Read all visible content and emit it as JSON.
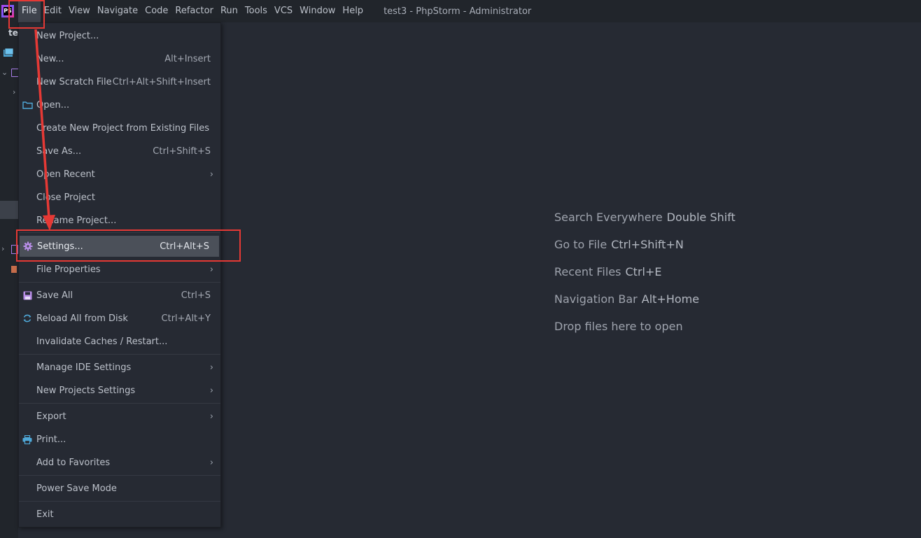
{
  "menubar": {
    "logo_text": "PS",
    "items": [
      "File",
      "Edit",
      "View",
      "Navigate",
      "Code",
      "Refactor",
      "Run",
      "Tools",
      "VCS",
      "Window",
      "Help"
    ],
    "window_title": "test3 - PhpStorm - Administrator"
  },
  "project_panel": {
    "tab_label": "te"
  },
  "file_menu": {
    "items": [
      {
        "label": "New Project...",
        "shortcut": "",
        "icon": "",
        "submenu": false
      },
      {
        "label": "New...",
        "shortcut": "Alt+Insert",
        "icon": "",
        "submenu": false
      },
      {
        "label": "New Scratch File",
        "shortcut": "Ctrl+Alt+Shift+Insert",
        "icon": "",
        "submenu": false
      },
      {
        "label": "Open...",
        "shortcut": "",
        "icon": "folder-icon",
        "submenu": false
      },
      {
        "label": "Create New Project from Existing Files",
        "shortcut": "",
        "icon": "",
        "submenu": false
      },
      {
        "label": "Save As...",
        "shortcut": "Ctrl+Shift+S",
        "icon": "",
        "submenu": false
      },
      {
        "label": "Open Recent",
        "shortcut": "",
        "icon": "",
        "submenu": true
      },
      {
        "label": "Close Project",
        "shortcut": "",
        "icon": "",
        "submenu": false
      },
      {
        "label": "Rename Project...",
        "shortcut": "",
        "icon": "",
        "submenu": false
      },
      {
        "label": "Settings...",
        "shortcut": "Ctrl+Alt+S",
        "icon": "gear-icon",
        "submenu": false,
        "selected": true
      },
      {
        "label": "File Properties",
        "shortcut": "",
        "icon": "",
        "submenu": true
      },
      {
        "label": "Save All",
        "shortcut": "Ctrl+S",
        "icon": "save-icon",
        "submenu": false
      },
      {
        "label": "Reload All from Disk",
        "shortcut": "Ctrl+Alt+Y",
        "icon": "reload-icon",
        "submenu": false
      },
      {
        "label": "Invalidate Caches / Restart...",
        "shortcut": "",
        "icon": "",
        "submenu": false
      },
      {
        "label": "Manage IDE Settings",
        "shortcut": "",
        "icon": "",
        "submenu": true
      },
      {
        "label": "New Projects Settings",
        "shortcut": "",
        "icon": "",
        "submenu": true
      },
      {
        "label": "Export",
        "shortcut": "",
        "icon": "",
        "submenu": true
      },
      {
        "label": "Print...",
        "shortcut": "",
        "icon": "print-icon",
        "submenu": false
      },
      {
        "label": "Add to Favorites",
        "shortcut": "",
        "icon": "",
        "submenu": true
      },
      {
        "label": "Power Save Mode",
        "shortcut": "",
        "icon": "",
        "submenu": false
      },
      {
        "label": "Exit",
        "shortcut": "",
        "icon": "",
        "submenu": false
      }
    ]
  },
  "editor_hints": [
    {
      "text": "Search Everywhere",
      "key": "Double Shift"
    },
    {
      "text": "Go to File",
      "key": "Ctrl+Shift+N"
    },
    {
      "text": "Recent Files",
      "key": "Ctrl+E"
    },
    {
      "text": "Navigation Bar",
      "key": "Alt+Home"
    },
    {
      "text": "Drop files here to open",
      "key": ""
    }
  ],
  "colors": {
    "background": "#262a33",
    "menubar": "#21252b",
    "selection": "#4b5059",
    "annotation": "#e53935",
    "icon_blue": "#4fa8d8",
    "icon_purple": "#b98ee8"
  }
}
